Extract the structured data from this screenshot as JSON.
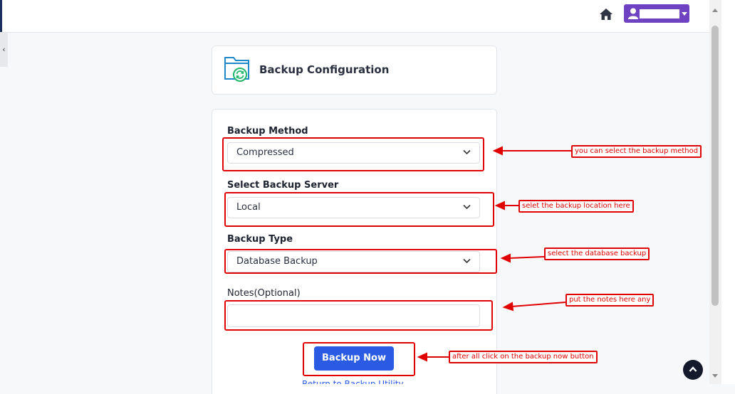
{
  "header": {
    "icons": [
      "home-icon",
      "user-icon"
    ]
  },
  "page": {
    "title": "Backup Configuration"
  },
  "form": {
    "backup_method": {
      "label": "Backup Method",
      "value": "Compressed"
    },
    "backup_server": {
      "label": "Select Backup Server",
      "value": "Local"
    },
    "backup_type": {
      "label": "Backup Type",
      "value": "Database Backup"
    },
    "notes": {
      "label": "Notes(Optional)",
      "value": ""
    },
    "submit_label": "Backup Now",
    "peek_link": "Return to Backup Utility"
  },
  "annotations": {
    "method": "you can select the backup method",
    "server": "selet the backup location here",
    "type": "select the database backup",
    "notes": "put the notes here any",
    "button": "after all click on the backup now button"
  },
  "colors": {
    "accent": "#6f42c1",
    "primary": "#2c5be3",
    "annotation": "#e00000",
    "folder": "#1e88c8",
    "sync": "#20b76a"
  }
}
